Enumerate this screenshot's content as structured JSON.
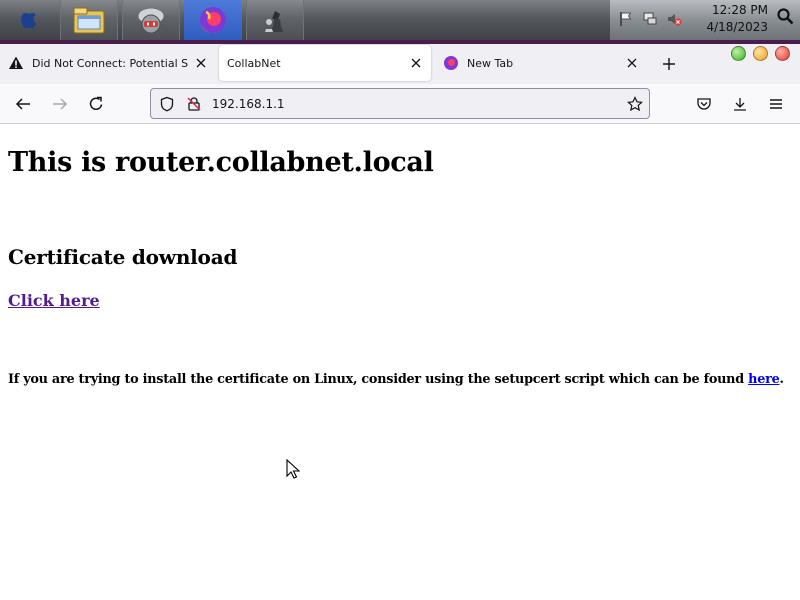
{
  "taskbar": {
    "apps": [
      "finder-icon",
      "file-manager-icon",
      "network-tool-icon",
      "firefox-icon",
      "chess-icon"
    ],
    "tray_icons": [
      "flag-icon",
      "network-icon",
      "volume-muted-icon"
    ],
    "clock_time": "12:28 PM",
    "clock_date": "4/18/2023"
  },
  "tabs": [
    {
      "label": "Did Not Connect: Potential Sec",
      "icon": "warning-icon",
      "selected": false
    },
    {
      "label": "CollabNet",
      "icon": "",
      "selected": true
    },
    {
      "label": "New Tab",
      "icon": "firefox-icon",
      "selected": false
    }
  ],
  "navbar": {
    "url": "192.168.1.1"
  },
  "page": {
    "heading": "This is router.collabnet.local",
    "subheading": "Certificate download",
    "download_link": "Click here",
    "note_text": "If you are trying to install the certificate on Linux, consider using the setupcert script which can be found ",
    "note_link": "here",
    "note_end": "."
  },
  "colors": {
    "visited_link": "#551a8b",
    "link": "#0000ee",
    "taskbar_active": "#2f5cc0"
  }
}
